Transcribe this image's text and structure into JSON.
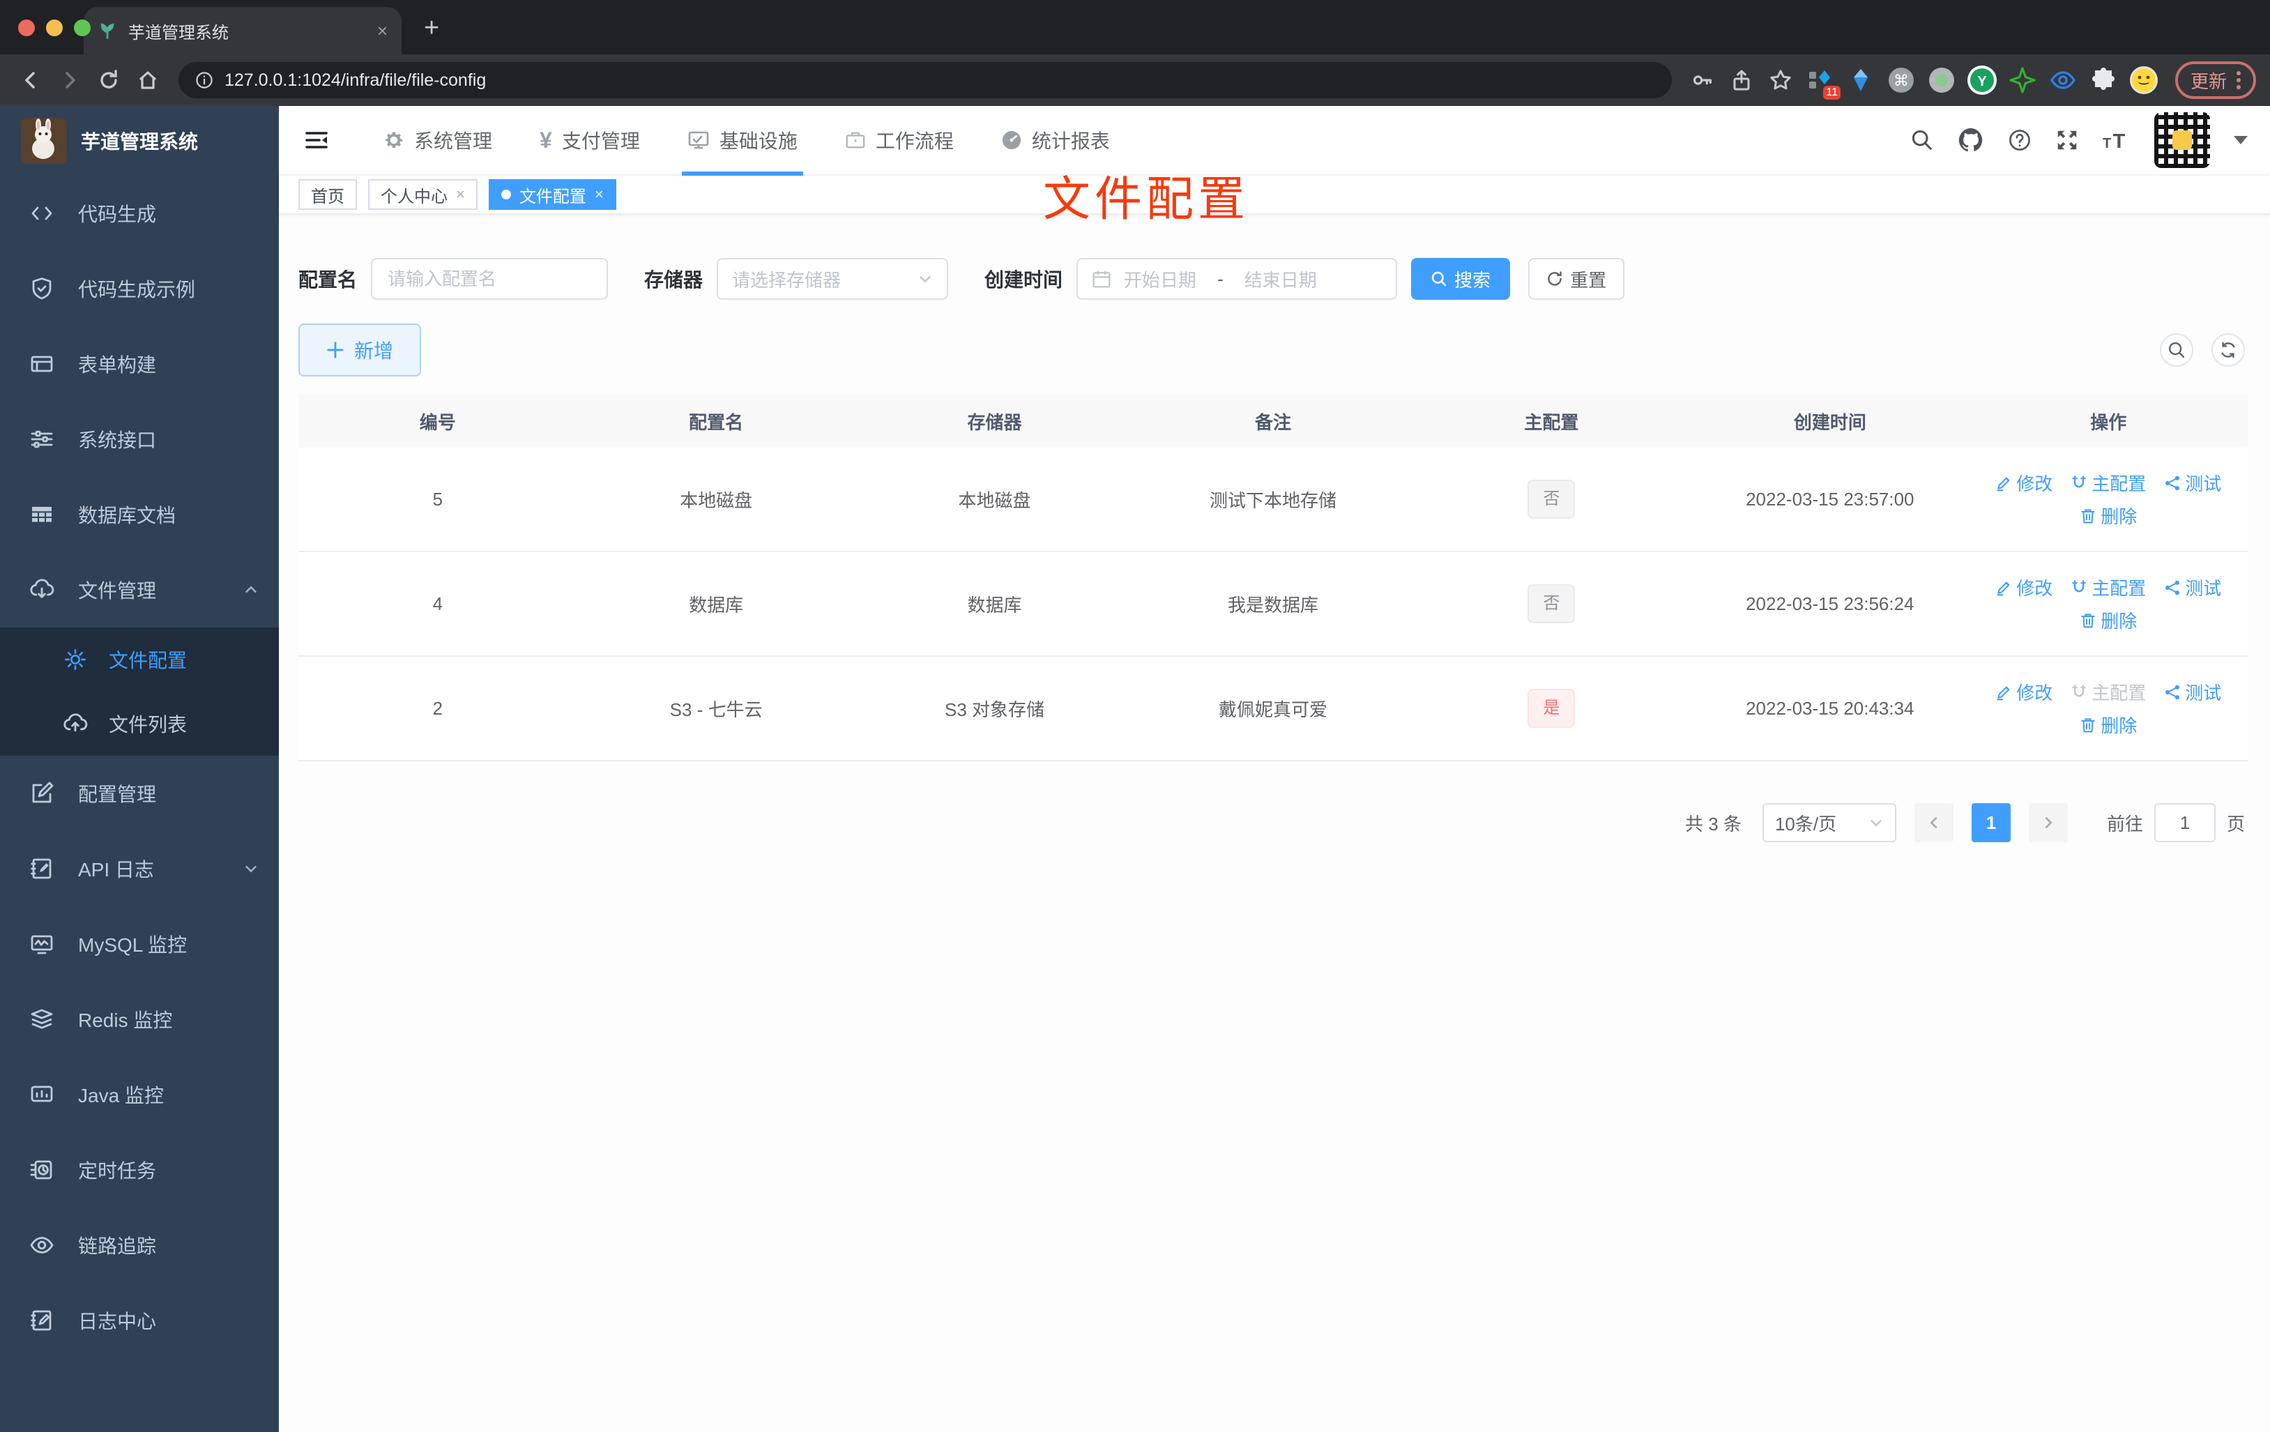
{
  "browser": {
    "tab_title": "芋道管理系统",
    "url": "127.0.0.1:1024/infra/file/file-config",
    "update_label": "更新",
    "extension_badge": "11"
  },
  "glyphs": {
    "close": "×",
    "new_tab": "+",
    "range_sep": "-"
  },
  "colors": {
    "accent": "#409eff",
    "danger": "#f56c6c",
    "annotation": "#f53a0e",
    "sidebar_bg": "#304156",
    "submenu_bg": "#1f2d3d"
  },
  "sidebar": {
    "title": "芋道管理系统",
    "items": [
      {
        "icon": "code-icon",
        "label": "代码生成"
      },
      {
        "icon": "shield-check-icon",
        "label": "代码生成示例"
      },
      {
        "icon": "form-icon",
        "label": "表单构建"
      },
      {
        "icon": "sliders-icon",
        "label": "系统接口"
      },
      {
        "icon": "db-table-icon",
        "label": "数据库文档"
      },
      {
        "icon": "cloud-download-icon",
        "label": "文件管理"
      },
      {
        "icon": "gear-icon",
        "label": "文件配置"
      },
      {
        "icon": "cloud-upload-icon",
        "label": "文件列表"
      },
      {
        "icon": "edit-square-icon",
        "label": "配置管理"
      },
      {
        "icon": "log-edit-icon",
        "label": "API 日志"
      },
      {
        "icon": "monitor-chart-icon",
        "label": "MySQL 监控"
      },
      {
        "icon": "layers-icon",
        "label": "Redis 监控"
      },
      {
        "icon": "dashboard-icon",
        "label": "Java 监控"
      },
      {
        "icon": "schedule-icon",
        "label": "定时任务"
      },
      {
        "icon": "eye-icon",
        "label": "链路追踪"
      },
      {
        "icon": "log-edit-icon",
        "label": "日志中心"
      }
    ]
  },
  "topnav": {
    "items": [
      "系统管理",
      "支付管理",
      "基础设施",
      "工作流程",
      "统计报表"
    ],
    "active_index": 2,
    "yen_glyph": "¥"
  },
  "tags": [
    "首页",
    "个人中心",
    "文件配置"
  ],
  "annotation": {
    "text": "文件配置"
  },
  "filters": {
    "name_label": "配置名",
    "name_placeholder": "请输入配置名",
    "storage_label": "存储器",
    "storage_placeholder": "请选择存储器",
    "time_label": "创建时间",
    "start_placeholder": "开始日期",
    "end_placeholder": "结束日期",
    "search_label": "搜索",
    "reset_label": "重置",
    "add_label": "新增"
  },
  "table": {
    "headers": [
      "编号",
      "配置名",
      "存储器",
      "备注",
      "主配置",
      "创建时间",
      "操作"
    ],
    "action_labels": {
      "modify": "修改",
      "master": "主配置",
      "test": "测试",
      "del": "删除"
    },
    "rows": [
      {
        "id": "5",
        "name": "本地磁盘",
        "storage": "本地磁盘",
        "remark": "测试下本地存储",
        "master": "否",
        "created": "2022-03-15 23:57:00"
      },
      {
        "id": "4",
        "name": "数据库",
        "storage": "数据库",
        "remark": "我是数据库",
        "master": "否",
        "created": "2022-03-15 23:56:24"
      },
      {
        "id": "2",
        "name": "S3 - 七牛云",
        "storage": "S3 对象存储",
        "remark": "戴佩妮真可爱",
        "master": "是",
        "created": "2022-03-15 20:43:34"
      }
    ]
  },
  "pagination": {
    "total_label": "共 3 条",
    "page_size": "10条/页",
    "current_page": "1",
    "goto_label": "前往",
    "page_unit": "页",
    "goto_value": "1"
  }
}
